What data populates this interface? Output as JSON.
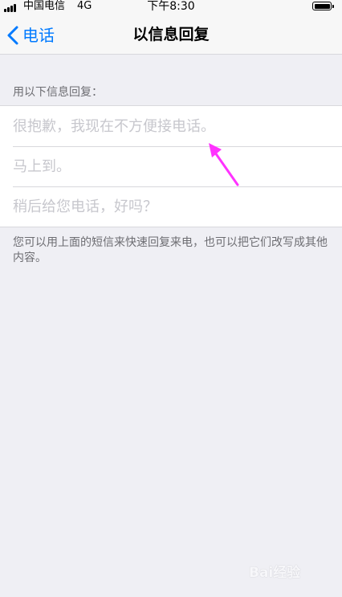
{
  "status_bar": {
    "carrier": "中国电信",
    "network": "4G",
    "time": "下午8:30",
    "signal_icon": "signal-bars-icon",
    "battery_icon": "battery-icon"
  },
  "nav": {
    "back_label": "电话",
    "back_icon": "chevron-left-icon",
    "title": "以信息回复",
    "accent_color": "#007aff"
  },
  "section": {
    "header": "用以下信息回复："
  },
  "replies": [
    {
      "value": "",
      "placeholder": "很抱歉，我现在不方便接电话。"
    },
    {
      "value": "",
      "placeholder": "马上到。"
    },
    {
      "value": "",
      "placeholder": "稍后给您电话，好吗？"
    }
  ],
  "footer_note": "您可以用上面的短信来快速回复来电，也可以把它们改写成其他内容。",
  "annotation": {
    "arrow_color": "#ff33ff",
    "arrow_icon": "pointer-arrow-icon"
  },
  "watermark": {
    "text": "Bai经验"
  }
}
